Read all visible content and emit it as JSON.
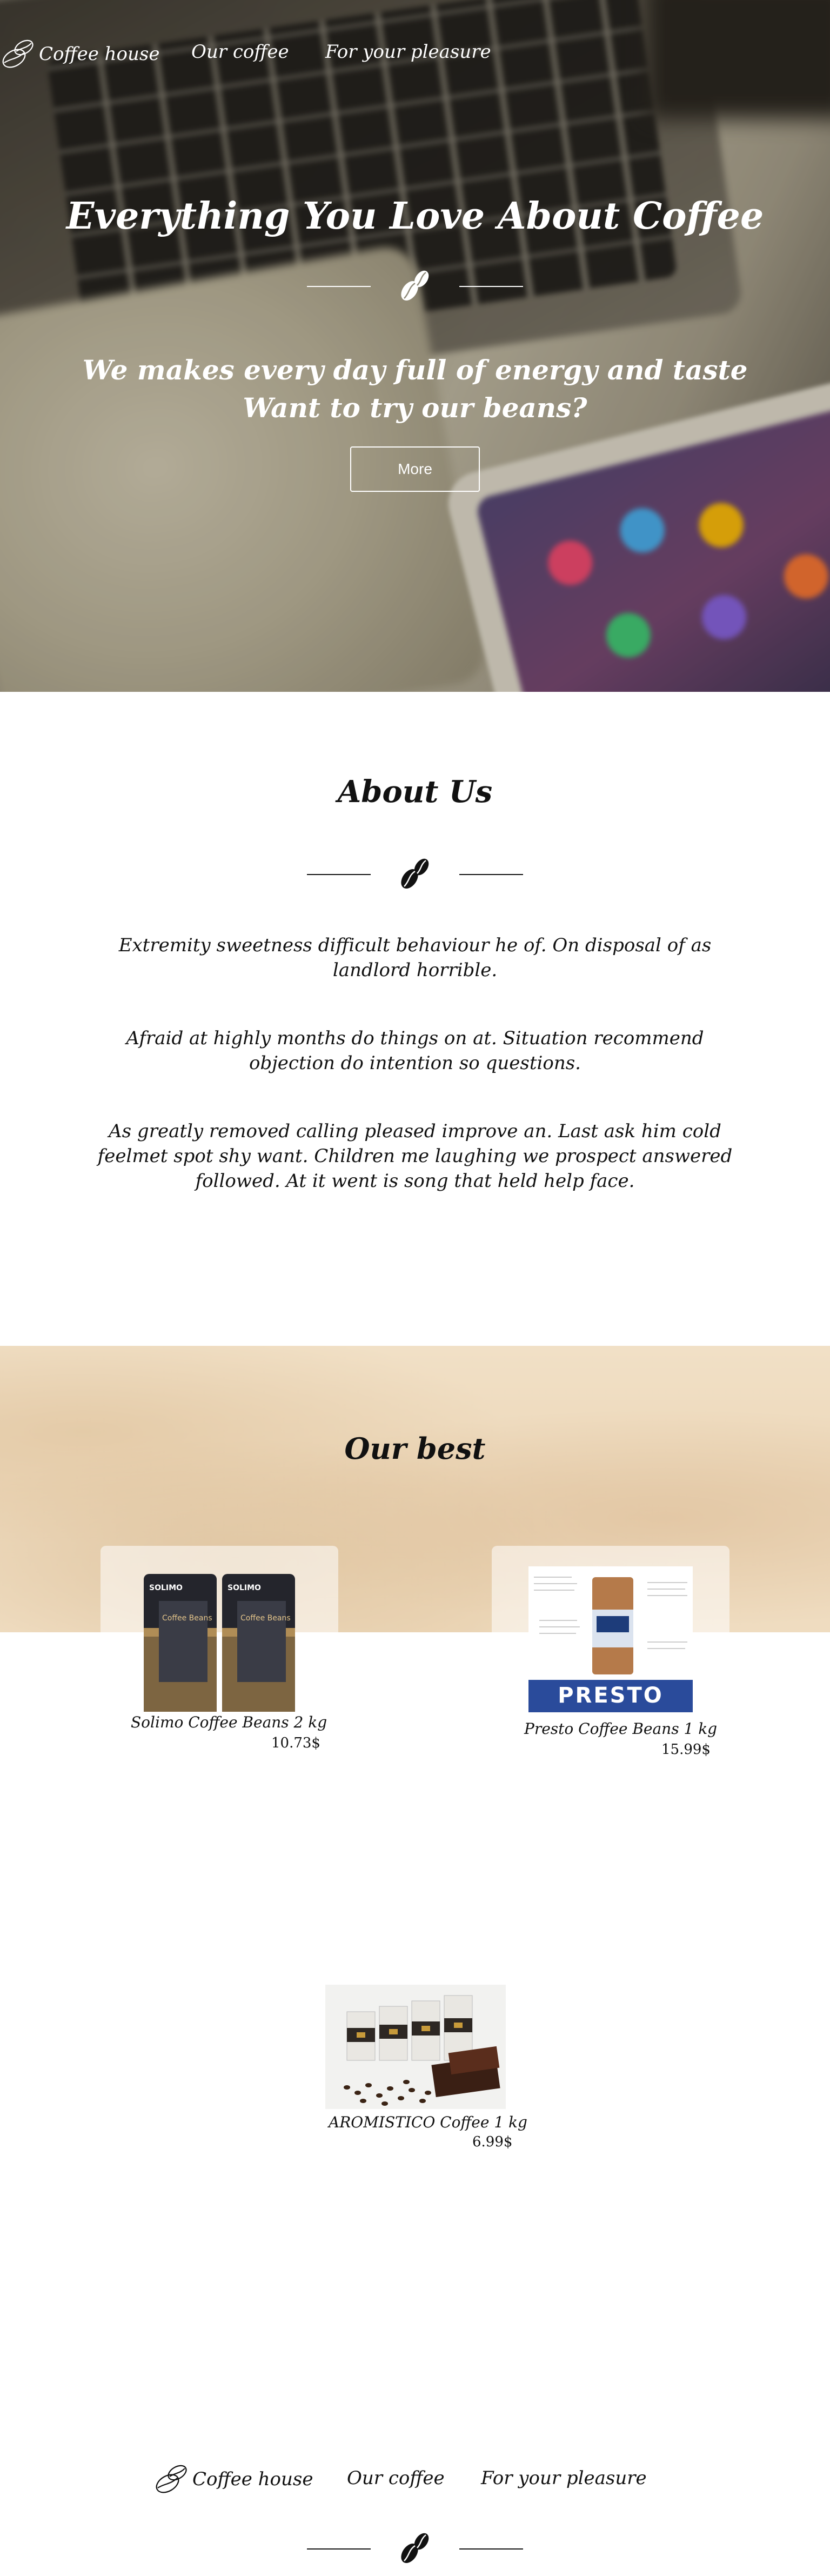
{
  "nav": {
    "brand": "Coffee house",
    "links": [
      "Our coffee",
      "For your pleasure"
    ]
  },
  "hero": {
    "title": "Everything You Love About Coffee",
    "subtitle_line1": "We makes every day full of energy and taste",
    "subtitle_line2": "Want to try our beans?",
    "button": "More"
  },
  "about": {
    "title": "About Us",
    "paragraphs": [
      "Extremity sweetness difficult behaviour he of. On disposal of as landlord horrible.",
      "Afraid at highly months do things on at. Situation recommend objection do intention so questions.",
      "As greatly removed calling pleased improve an. Last ask him cold feelmet spot shy want. Children me laughing we prospect answered followed. At it went is song that held help face."
    ]
  },
  "best": {
    "title": "Our best",
    "items": [
      {
        "name": "Solimo Coffee Beans 2 kg",
        "price": "10.73$",
        "package_text": "SOLIMO",
        "package_sub": "Coffee Beans"
      },
      {
        "name": "Presto Coffee Beans 1 kg",
        "price": "15.99$",
        "package_text": "PRESTO"
      },
      {
        "name": "AROMISTICO Coffee 1 kg",
        "price": "6.99$"
      }
    ]
  },
  "colors": {
    "hero_text": "#ffffff",
    "body_text": "#111111",
    "presto_blue": "#2a4b9b",
    "paper_bg": "#efdcc0"
  },
  "icons": {
    "logo": "coffee-beans-outline-icon",
    "divider": "coffee-beans-icon"
  }
}
